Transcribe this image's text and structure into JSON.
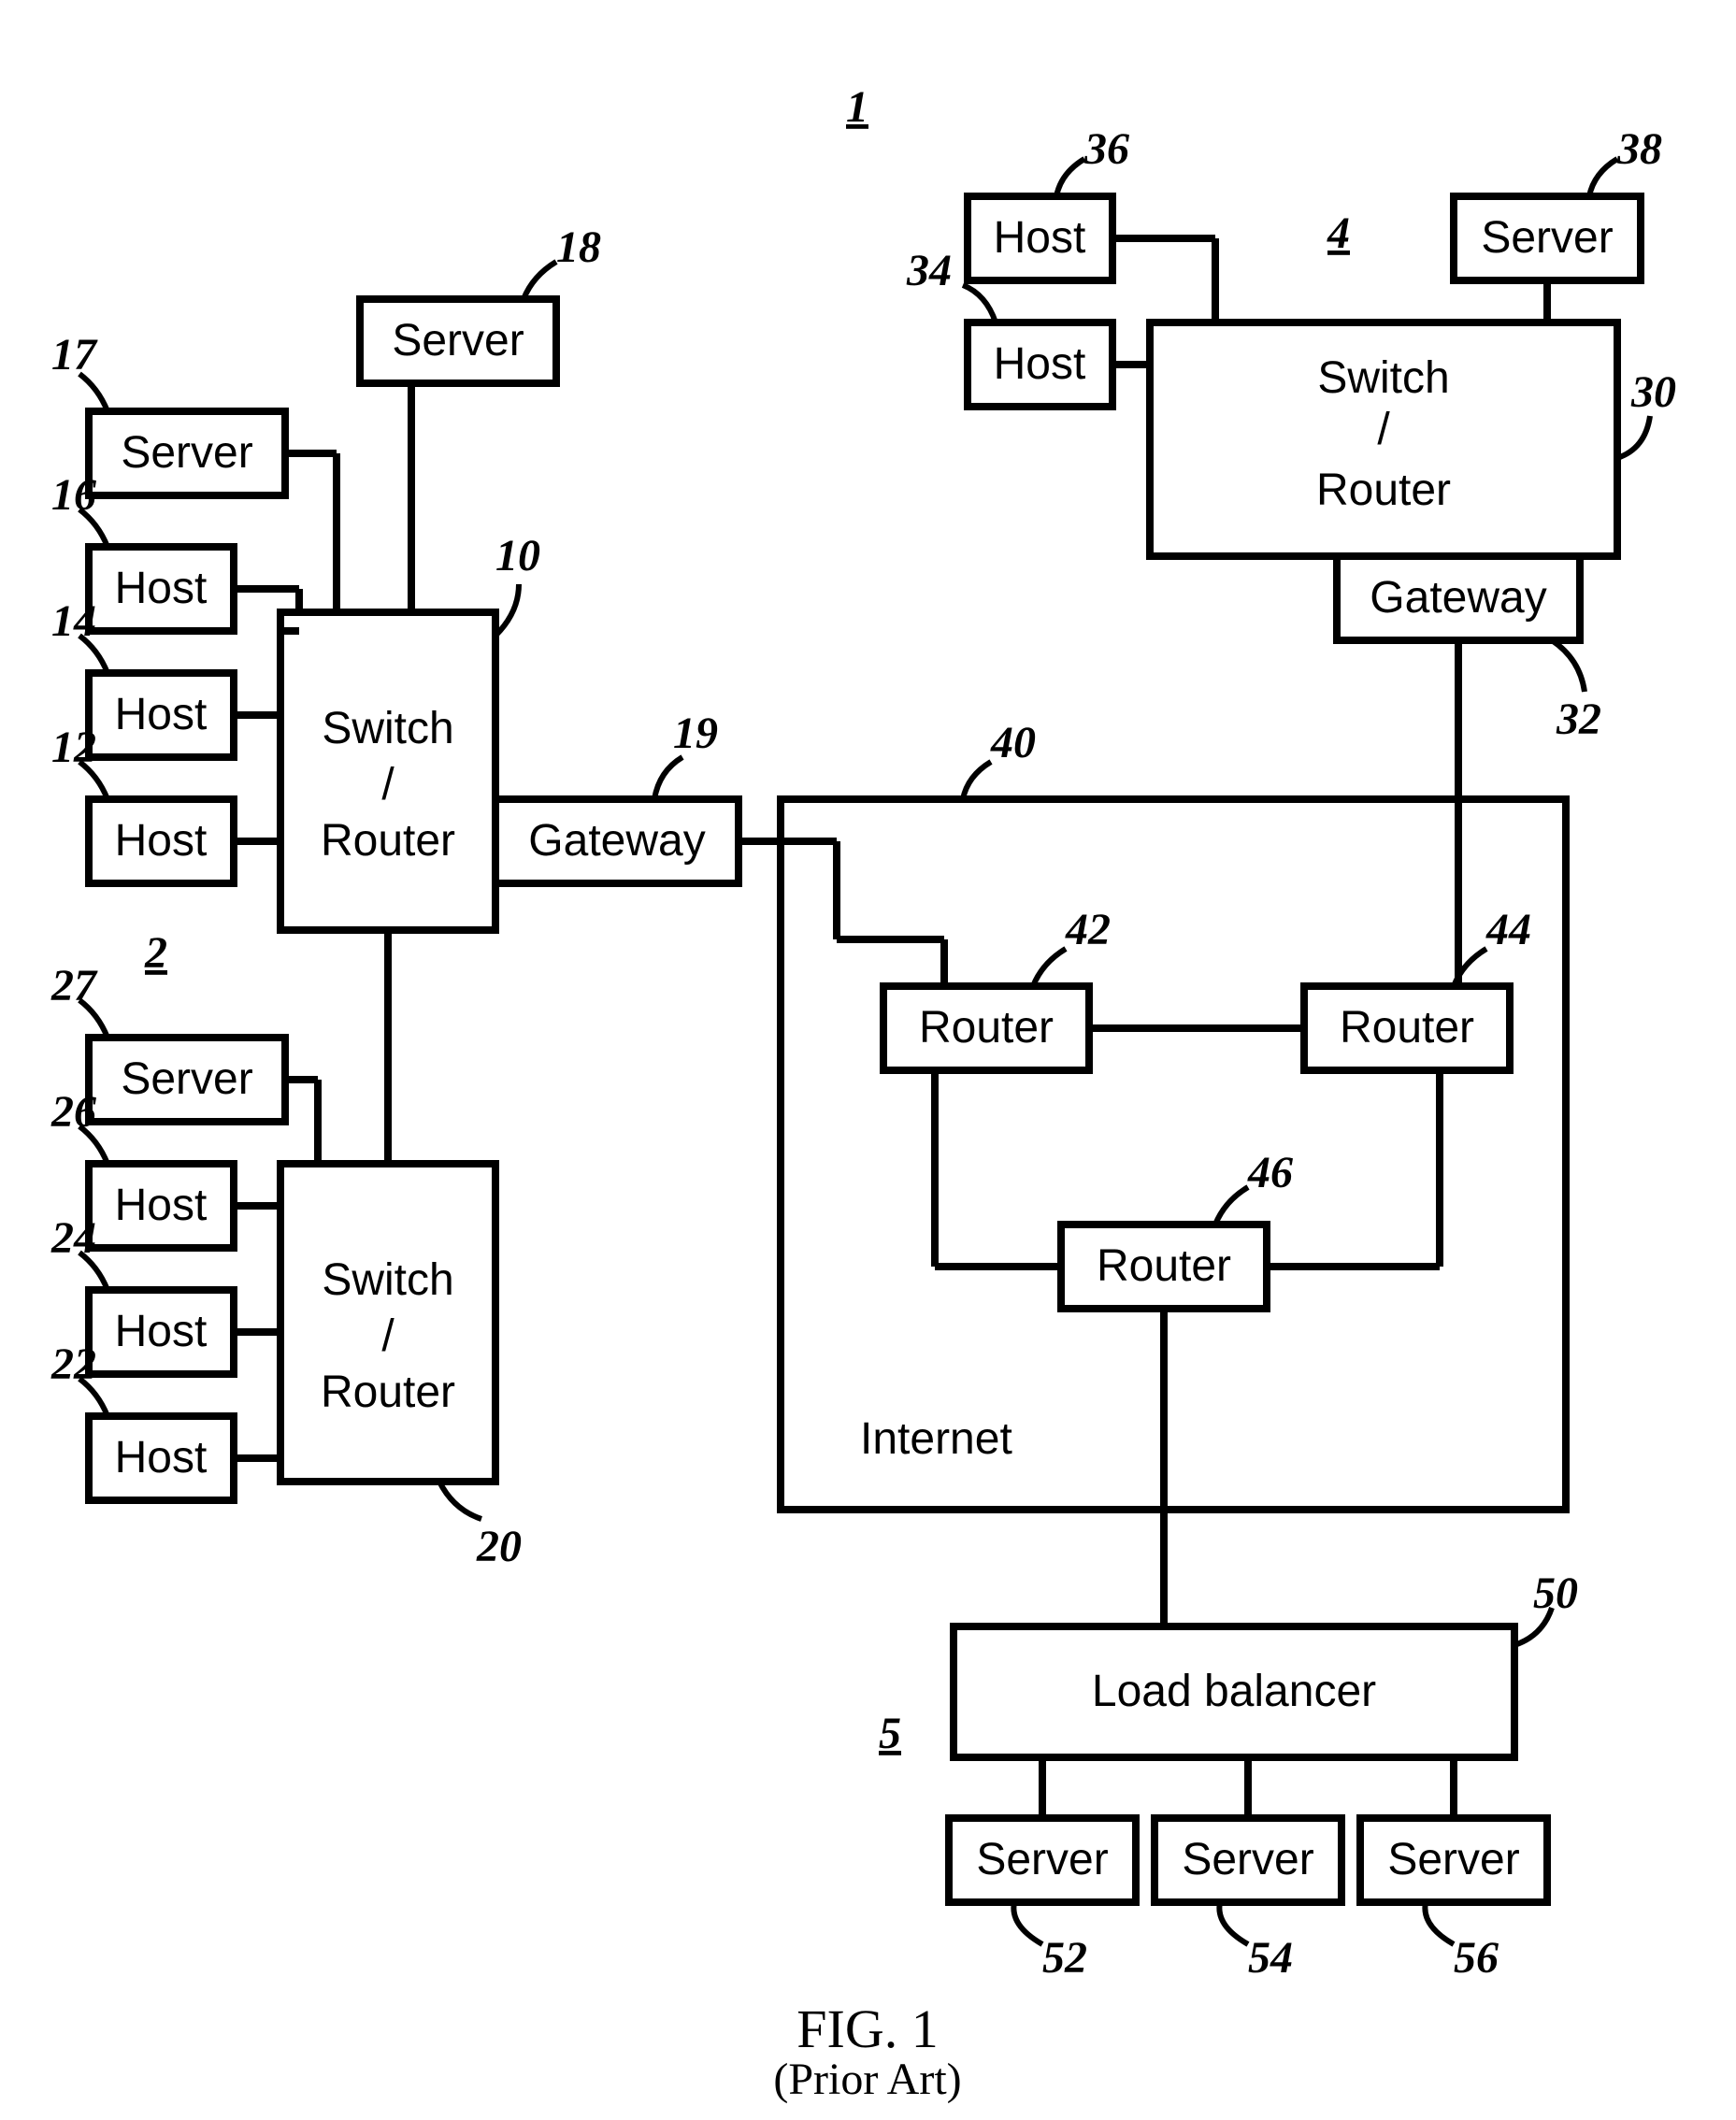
{
  "figure": {
    "title": "FIG. 1",
    "subtitle": "(Prior Art)",
    "overall_ref": "1"
  },
  "region2": {
    "ref": "2",
    "switch_router": {
      "ref": "10",
      "l1": "Switch",
      "l2": "/",
      "l3": "Router"
    },
    "gateway": {
      "ref": "19",
      "label": "Gateway"
    },
    "host12": {
      "ref": "12",
      "label": "Host"
    },
    "host14": {
      "ref": "14",
      "label": "Host"
    },
    "host16": {
      "ref": "16",
      "label": "Host"
    },
    "server17": {
      "ref": "17",
      "label": "Server"
    },
    "server18": {
      "ref": "18",
      "label": "Server"
    }
  },
  "region_lower_left": {
    "switch_router": {
      "ref": "20",
      "l1": "Switch",
      "l2": "/",
      "l3": "Router"
    },
    "host22": {
      "ref": "22",
      "label": "Host"
    },
    "host24": {
      "ref": "24",
      "label": "Host"
    },
    "host26": {
      "ref": "26",
      "label": "Host"
    },
    "server27": {
      "ref": "27",
      "label": "Server"
    }
  },
  "region4": {
    "ref": "4",
    "switch_router": {
      "ref": "30",
      "l1": "Switch",
      "l2": "/",
      "l3": "Router"
    },
    "gateway": {
      "ref": "32",
      "label": "Gateway"
    },
    "host34": {
      "ref": "34",
      "label": "Host"
    },
    "host36": {
      "ref": "36",
      "label": "Host"
    },
    "server38": {
      "ref": "38",
      "label": "Server"
    }
  },
  "internet": {
    "ref": "40",
    "label": "Internet",
    "router42": {
      "ref": "42",
      "label": "Router"
    },
    "router44": {
      "ref": "44",
      "label": "Router"
    },
    "router46": {
      "ref": "46",
      "label": "Router"
    }
  },
  "region5": {
    "ref": "5",
    "load_balancer": {
      "ref": "50",
      "label": "Load balancer"
    },
    "server52": {
      "ref": "52",
      "label": "Server"
    },
    "server54": {
      "ref": "54",
      "label": "Server"
    },
    "server56": {
      "ref": "56",
      "label": "Server"
    }
  }
}
